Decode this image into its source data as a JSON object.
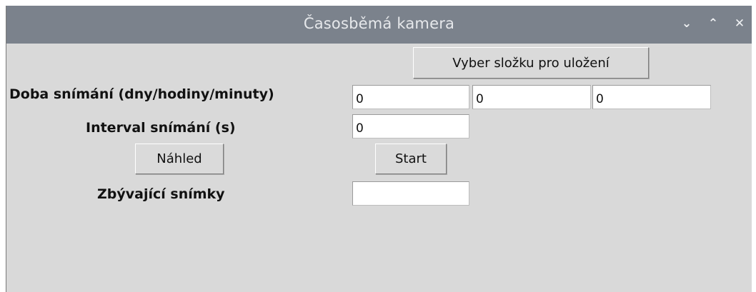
{
  "window": {
    "title": "Časosběmá kamera",
    "controls": {
      "minimize_icon": "⌄",
      "maximize_icon": "⌃",
      "close_icon": "✕"
    }
  },
  "folder_button_label": "Vyber složku pro uložení",
  "duration": {
    "label": "Doba snímání (dny/hodiny/minuty)",
    "days": "0",
    "hours": "0",
    "minutes": "0"
  },
  "interval": {
    "label": "Interval snímání (s)",
    "value": "0"
  },
  "preview_button_label": "Náhled",
  "start_button_label": "Start",
  "remaining": {
    "label": "Zbývající snímky",
    "value": ""
  }
}
